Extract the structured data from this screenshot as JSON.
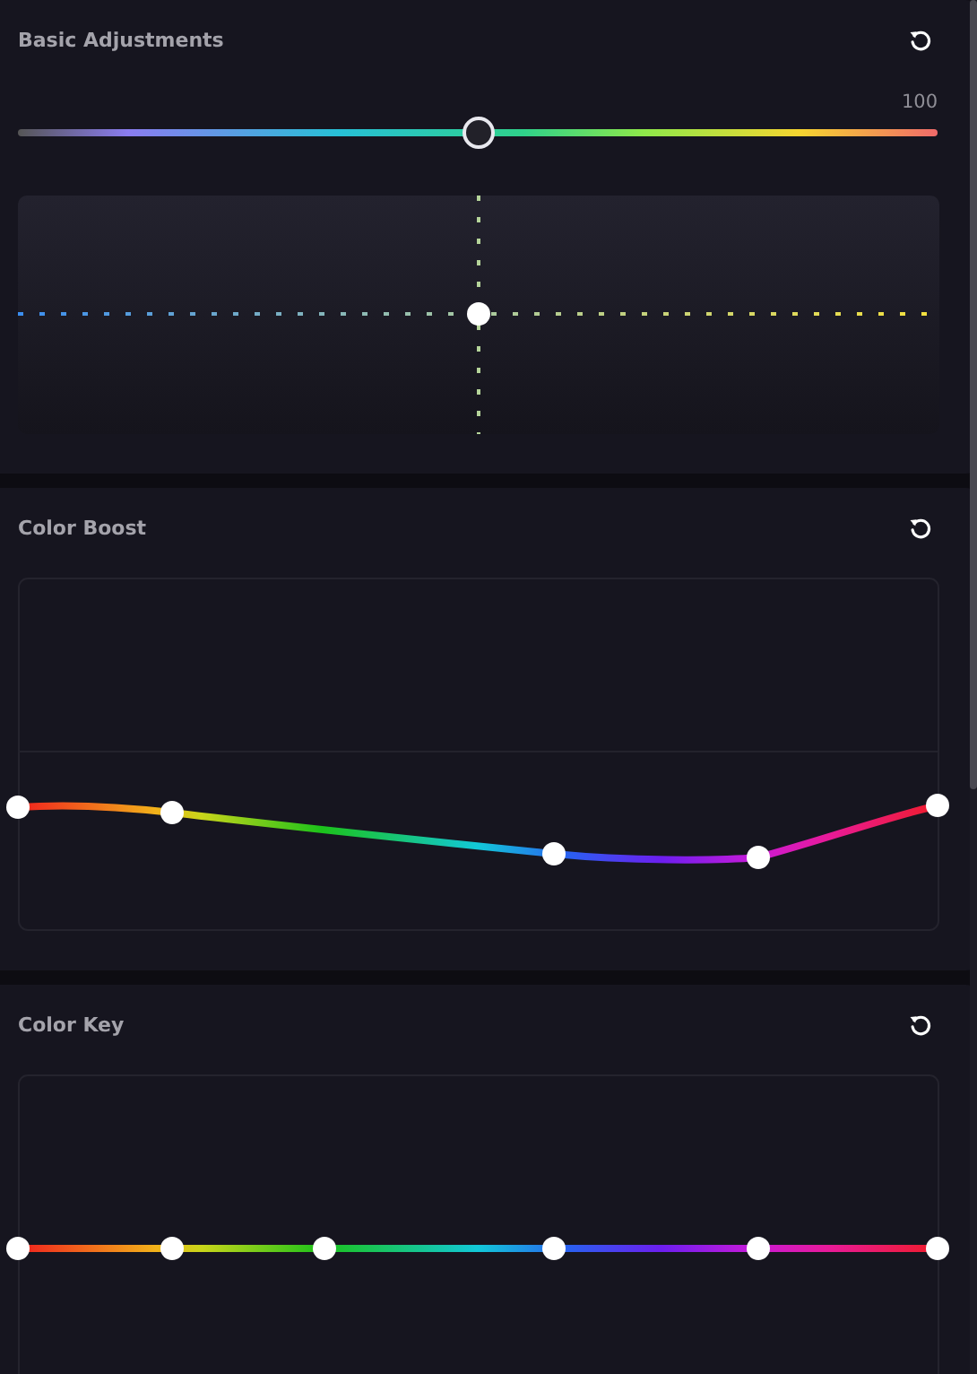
{
  "sections": [
    {
      "kind": "slider-pad",
      "title": "Basic Adjustments",
      "reading": "100",
      "level": 0.5
    },
    {
      "kind": "curve",
      "title": "Color Boost"
    },
    {
      "kind": "line",
      "title": "Color Key"
    }
  ]
}
